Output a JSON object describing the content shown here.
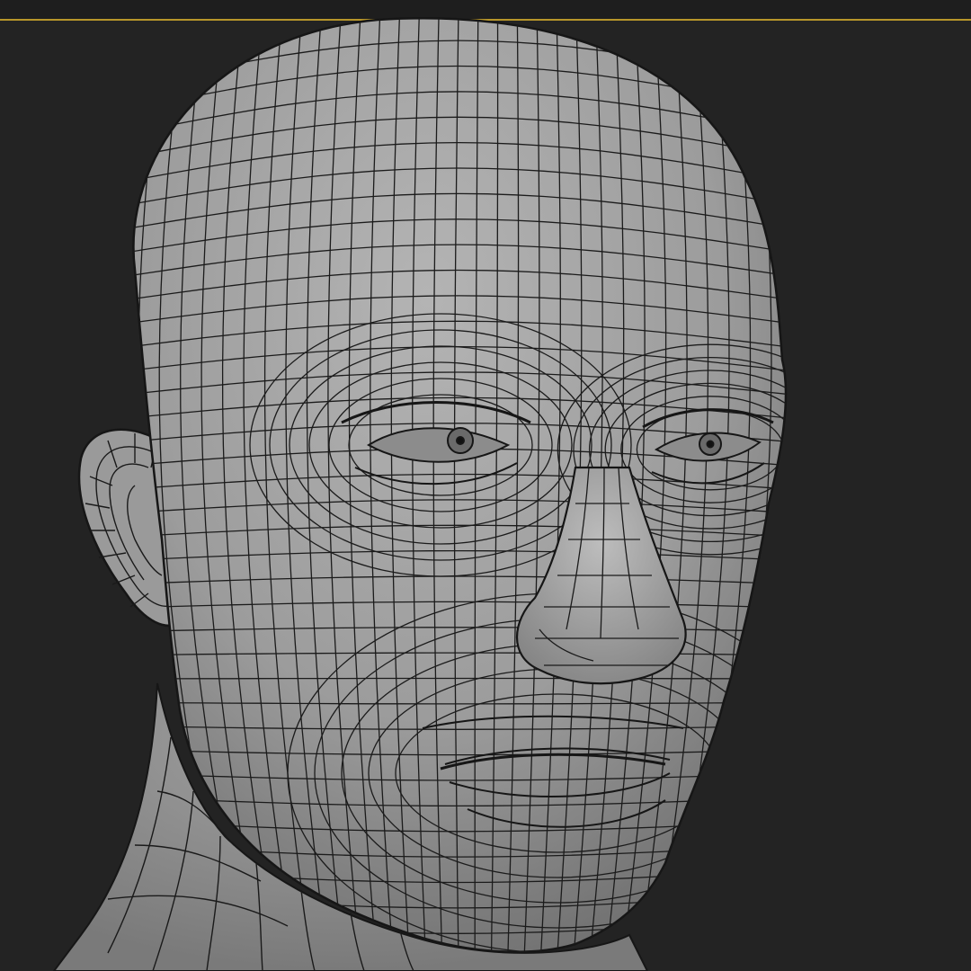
{
  "viewport": {
    "background_color": "#232323",
    "selection_frame_color": "#b8962a",
    "model_shade_color": "#9a9a9a",
    "wireframe_color": "#161616",
    "model": "head-wireframe-mesh"
  }
}
